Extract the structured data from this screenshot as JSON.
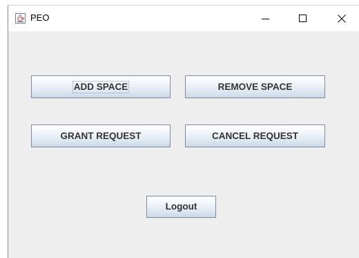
{
  "window": {
    "title": "PEO",
    "app_icon": "java-coffee-cup-icon",
    "controls": {
      "minimize_icon": "minimize-icon",
      "maximize_icon": "maximize-icon",
      "close_icon": "close-icon"
    }
  },
  "buttons": {
    "add_space": "ADD SPACE",
    "remove_space": "REMOVE SPACE",
    "grant_request": "GRANT REQUEST",
    "cancel_request": "CANCEL REQUEST",
    "logout": "Logout"
  },
  "colors": {
    "panel_background": "#eeeeee",
    "button_border": "#7a8aa0",
    "button_text": "#333333"
  }
}
